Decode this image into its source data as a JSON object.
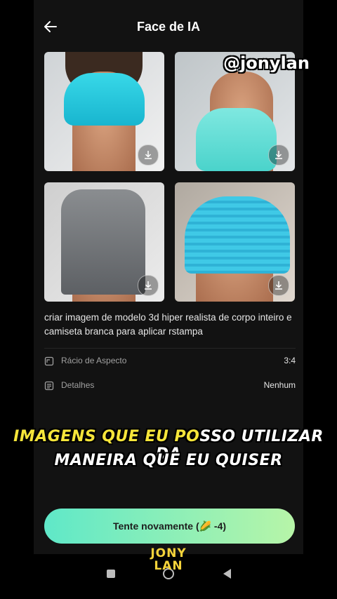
{
  "header": {
    "title": "Face de IA"
  },
  "watermark": {
    "handle": "@jonylan"
  },
  "gallery": {
    "download_icon": "download-icon"
  },
  "prompt": {
    "text": "criar imagem de modelo 3d hiper realista de corpo inteiro e camiseta branca para aplicar rstampa"
  },
  "settings": {
    "aspect": {
      "label": "Rácio de Aspecto",
      "value": "3:4"
    },
    "details": {
      "label": "Detalhes",
      "value": "Nenhum"
    }
  },
  "caption": {
    "line1_highlight": "IMAGENS QUE EU PO",
    "line1_rest": "SSO UTILIZAR DA",
    "line2": "MANEIRA QUE EU QUISER"
  },
  "cta": {
    "label": "Tente novamente (🌽 -4)"
  },
  "logo": {
    "line1": "JONY",
    "line2": "LAN"
  },
  "colors": {
    "accent_start": "#5fe8c8",
    "accent_end": "#b7f5a8",
    "caption_highlight": "#f5e53a"
  }
}
